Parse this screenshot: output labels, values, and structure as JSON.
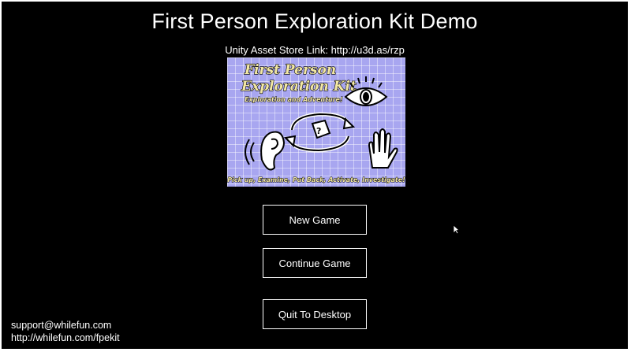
{
  "window": {
    "title": "First Person Exploration Kit Demo"
  },
  "store": {
    "link_text": "Unity Asset Store Link: http://u3d.as/rzp"
  },
  "banner": {
    "title_line1": "First Person",
    "title_line2": "Exploration Kit",
    "subtitle": "Exploration and Adventure!",
    "tagline": "Pick up, Examine, Put Back, Activate, Investigate!",
    "icons": [
      "eye-icon",
      "ear-icon",
      "rotate-item-icon",
      "hand-icon"
    ],
    "background_color": "#a8a6f0",
    "text_color": "#f3e8a4"
  },
  "menu": {
    "new_game": "New Game",
    "continue_game": "Continue Game",
    "quit": "Quit To Desktop"
  },
  "footer": {
    "email": "support@whilefun.com",
    "url": "http://whilefun.com/fpekit"
  },
  "colors": {
    "background": "#000000",
    "text": "#ffffff"
  }
}
